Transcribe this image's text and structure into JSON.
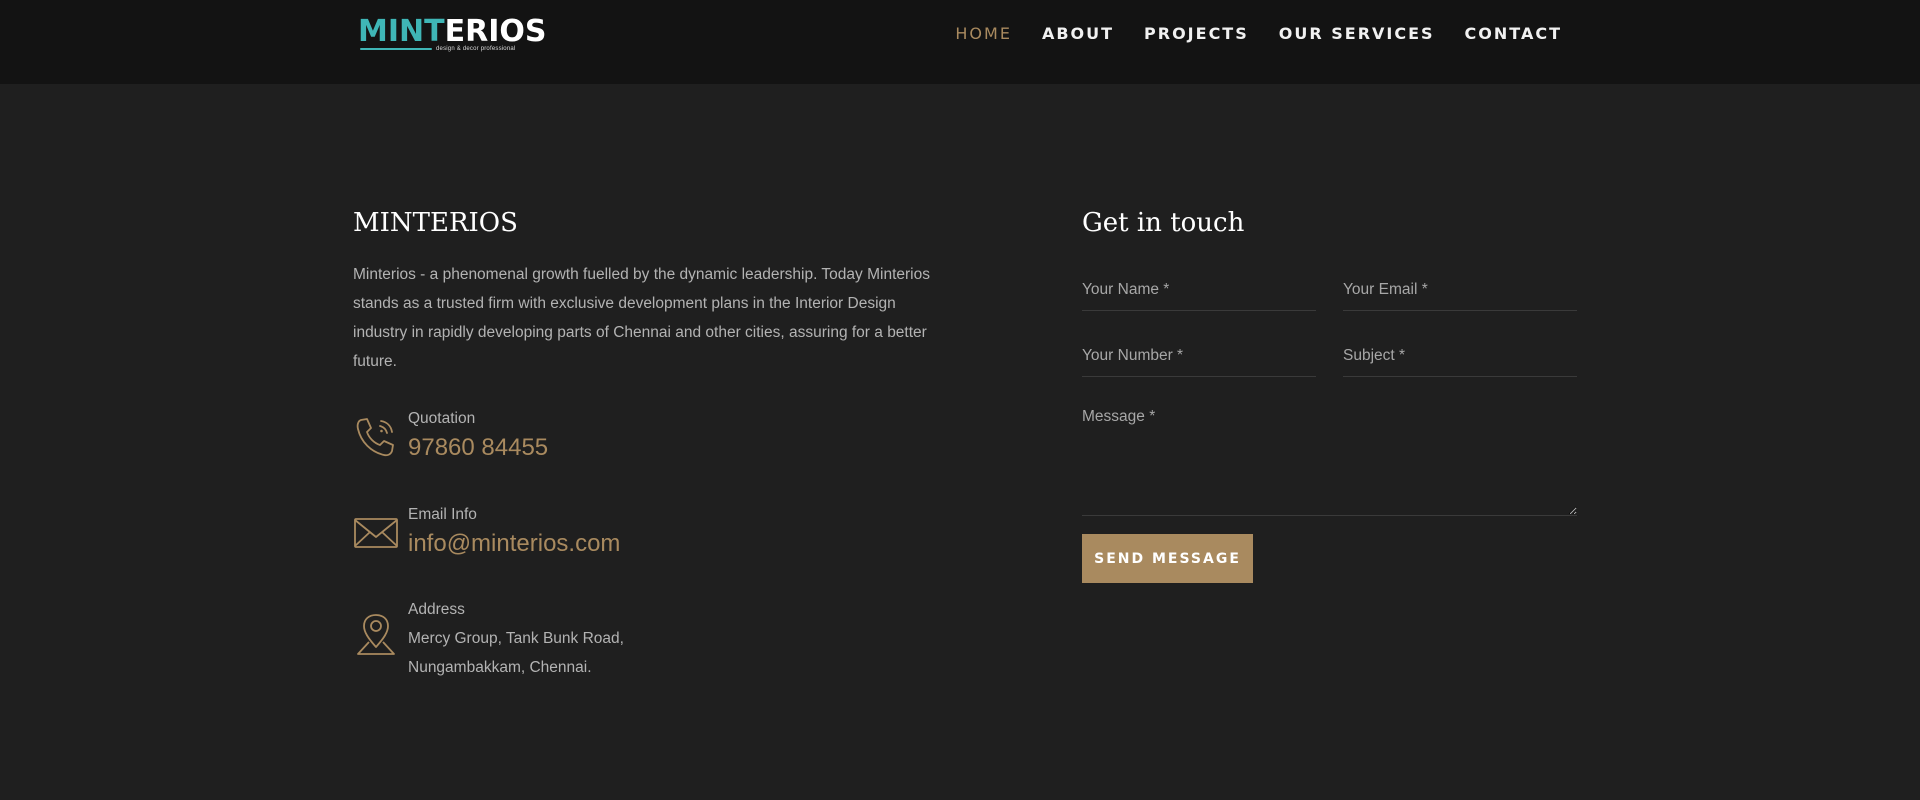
{
  "header": {
    "logo": {
      "mint": "MINT",
      "erios": "ERIOS",
      "tagline": "design & decor professional"
    },
    "nav": [
      {
        "label": "HOME",
        "active": true
      },
      {
        "label": "ABOUT",
        "active": false
      },
      {
        "label": "PROJECTS",
        "active": false
      },
      {
        "label": "OUR SERVICES",
        "active": false
      },
      {
        "label": "CONTACT",
        "active": false
      }
    ]
  },
  "about": {
    "title": "MINTERIOS",
    "text": "Minterios - a phenomenal growth fuelled by the dynamic leadership. Today Minterios stands as a trusted firm with exclusive development plans in the Interior Design industry in rapidly developing parts of Chennai and other cities, assuring for a better future."
  },
  "contacts": {
    "phone": {
      "label": "Quotation",
      "value": "97860 84455",
      "icon": "phone-icon"
    },
    "email": {
      "label": "Email Info",
      "value": "info@minterios.com",
      "icon": "envelope-icon"
    },
    "address": {
      "label": "Address",
      "line1": "Mercy Group, Tank Bunk Road,",
      "line2": "Nungambakkam, Chennai.",
      "icon": "location-pin-icon"
    }
  },
  "form": {
    "title": "Get in touch",
    "name_placeholder": "Your Name *",
    "email_placeholder": "Your Email *",
    "number_placeholder": "Your Number *",
    "subject_placeholder": "Subject *",
    "message_placeholder": "Message *",
    "send_label": "SEND MESSAGE"
  },
  "colors": {
    "accent": "#a98a5f",
    "brand_teal": "#3fb6b6",
    "background": "#1f1f1f",
    "header_background": "#131313"
  }
}
